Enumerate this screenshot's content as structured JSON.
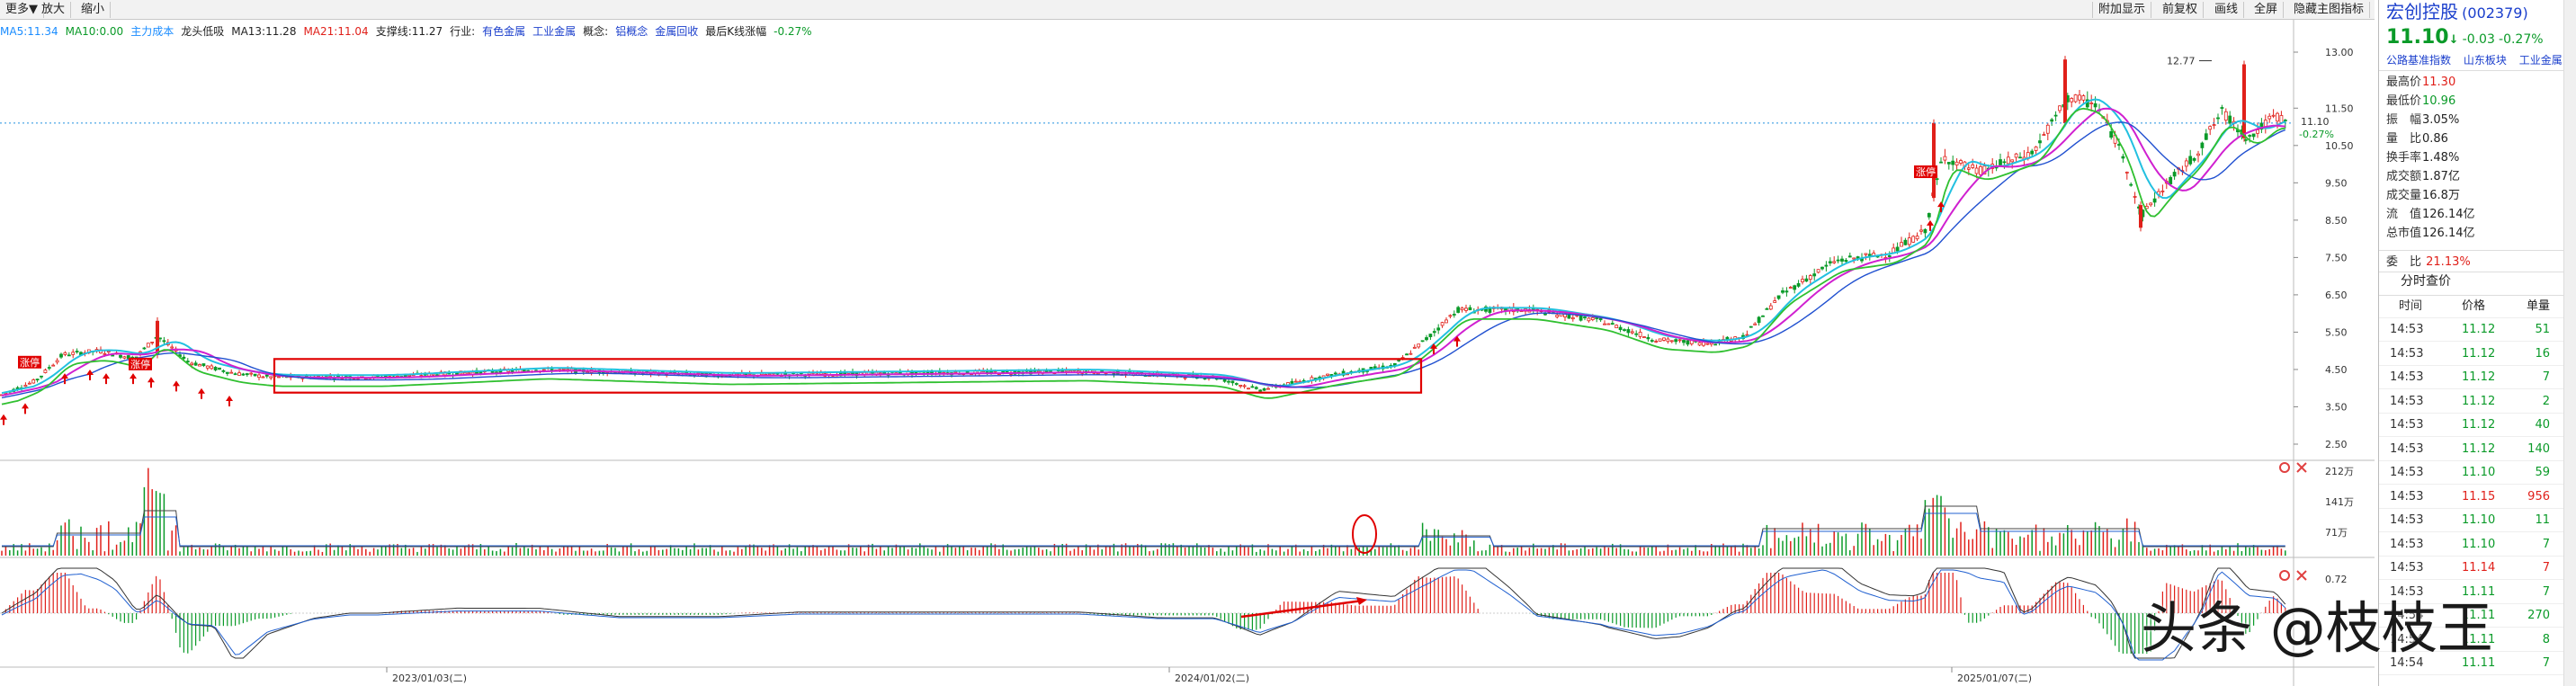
{
  "toolbar": {
    "left_items": [
      "更多▼",
      "放大",
      "缩小"
    ],
    "right_items": [
      "附加显示",
      "前复权",
      "画线",
      "全屏",
      "隐藏主图指标"
    ]
  },
  "indicators": {
    "items": [
      {
        "text": "MA5:11.34",
        "color": "#1a8cff"
      },
      {
        "text": "MA10:0.00",
        "color": "#0a9a28"
      },
      {
        "text": "主力成本",
        "color": "#1a8cff"
      },
      {
        "text": "龙头低吸",
        "color": "#222222"
      },
      {
        "text": "MA13:11.28",
        "color": "#222222"
      },
      {
        "text": "MA21:11.04",
        "color": "#e0201a"
      },
      {
        "text": "支撑线:11.27",
        "color": "#222222"
      },
      {
        "text": "行业:",
        "color": "#222222"
      },
      {
        "text": "有色金属",
        "color": "#1a3ecc"
      },
      {
        "text": "工业金属",
        "color": "#1a3ecc"
      },
      {
        "text": "概念:",
        "color": "#222222"
      },
      {
        "text": "铝概念",
        "color": "#1a3ecc"
      },
      {
        "text": "金属回收",
        "color": "#1a3ecc"
      },
      {
        "text": "最后K线涨幅",
        "color": "#222222"
      },
      {
        "text": "-0.27%",
        "color": "#0a9a28"
      }
    ]
  },
  "main_axis": {
    "ticks": [
      "13.00",
      "11.50",
      "10.50",
      "9.50",
      "8.50",
      "7.50",
      "6.50",
      "5.50",
      "4.50",
      "3.50",
      "2.50"
    ],
    "current_price": "11.10",
    "current_change": "-0.27%",
    "peak_label": "12.77"
  },
  "volume_axis": {
    "ticks": [
      "212万",
      "141万",
      "71万"
    ]
  },
  "macd_axis": {
    "ticks": [
      "0.72"
    ]
  },
  "date_axis": [
    "2023/01/03(二)",
    "2024/01/02(二)",
    "2025/01/07(二)"
  ],
  "chart_labels": {
    "limit_up": "涨停"
  },
  "stock": {
    "name": "宏创控股",
    "code": "(002379)",
    "price": "11.10",
    "price_arrow": "↓",
    "change": "-0.03",
    "change_pct": "-0.27%",
    "tags": [
      "公路基准指数",
      "山东板块",
      "工业金属"
    ]
  },
  "stats": [
    {
      "label": "最高价",
      "value": "11.30",
      "color": "red"
    },
    {
      "label": "最低价",
      "value": "10.96",
      "color": "green"
    },
    {
      "label": "振　幅",
      "value": "3.05%",
      "color": "plain"
    },
    {
      "label": "量　比",
      "value": "0.86",
      "color": "plain"
    },
    {
      "label": "换手率",
      "value": "1.48%",
      "color": "plain"
    },
    {
      "label": "成交额",
      "value": "1.87亿",
      "color": "plain"
    },
    {
      "label": "成交量",
      "value": "16.8万",
      "color": "plain"
    },
    {
      "label": "流　值",
      "value": "126.14亿",
      "color": "plain"
    },
    {
      "label": "总市值",
      "value": "126.14亿",
      "color": "plain"
    }
  ],
  "weibi": {
    "label": "委　比",
    "value": "21.13%"
  },
  "ticks_panel": {
    "title": "分时查价",
    "headers": [
      "时间",
      "价格",
      "单量"
    ],
    "rows": [
      {
        "time": "14:53",
        "price": "11.12",
        "vol": "51",
        "dir": "green"
      },
      {
        "time": "14:53",
        "price": "11.12",
        "vol": "16",
        "dir": "green"
      },
      {
        "time": "14:53",
        "price": "11.12",
        "vol": "7",
        "dir": "green"
      },
      {
        "time": "14:53",
        "price": "11.12",
        "vol": "2",
        "dir": "green"
      },
      {
        "time": "14:53",
        "price": "11.12",
        "vol": "40",
        "dir": "green"
      },
      {
        "time": "14:53",
        "price": "11.12",
        "vol": "140",
        "dir": "green"
      },
      {
        "time": "14:53",
        "price": "11.10",
        "vol": "59",
        "dir": "green"
      },
      {
        "time": "14:53",
        "price": "11.15",
        "vol": "956",
        "dir": "red"
      },
      {
        "time": "14:53",
        "price": "11.10",
        "vol": "11",
        "dir": "green"
      },
      {
        "time": "14:53",
        "price": "11.10",
        "vol": "7",
        "dir": "green"
      },
      {
        "time": "14:53",
        "price": "11.14",
        "vol": "7",
        "dir": "red"
      },
      {
        "time": "14:53",
        "price": "11.11",
        "vol": "7",
        "dir": "green"
      },
      {
        "time": "14:54",
        "price": "11.11",
        "vol": "270",
        "dir": "green"
      },
      {
        "time": "14:54",
        "price": "11.11",
        "vol": "8",
        "dir": "green"
      },
      {
        "time": "14:54",
        "price": "11.11",
        "vol": "7",
        "dir": "green"
      }
    ]
  },
  "watermark": "头条 @枝枝王",
  "colors": {
    "up": "#e0201a",
    "down": "#0a9a28",
    "ma_purple": "#d020d0",
    "ma_cyan": "#22c0e0",
    "ma_blue": "#2050d0"
  }
}
